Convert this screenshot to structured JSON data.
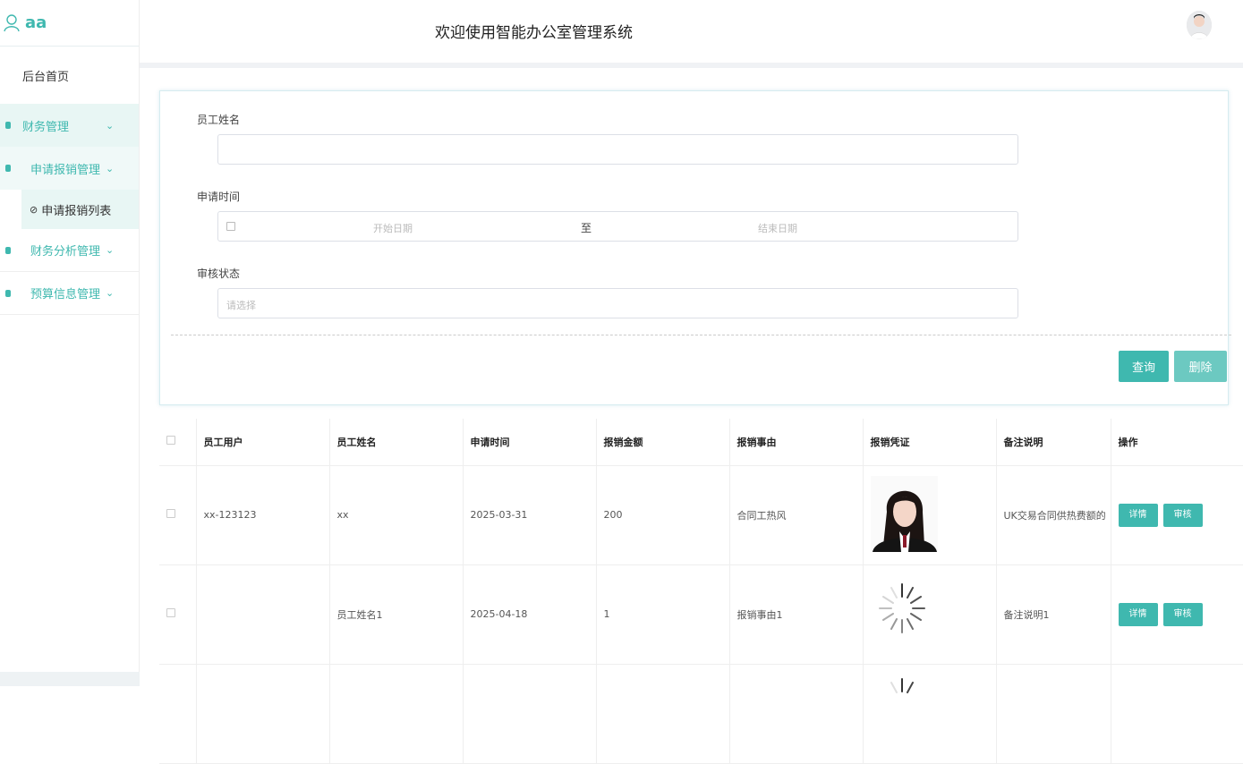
{
  "brand": {
    "name": "aa"
  },
  "sidebar": {
    "home": "后台首页",
    "finance": "财务管理",
    "reimburse": "申请报销管理",
    "reimburse_list": "申请报销列表",
    "analysis": "财务分析管理",
    "budget": "预算信息管理"
  },
  "header": {
    "title": "欢迎使用智能办公室管理系统"
  },
  "search": {
    "name_label": "员工姓名",
    "name_value": "",
    "time_label": "申请时间",
    "start_placeholder": "开始日期",
    "range_separator": "至",
    "end_placeholder": "结束日期",
    "status_label": "审核状态",
    "status_placeholder": "请选择",
    "query_label": "查询",
    "delete_label": "删除"
  },
  "table": {
    "headers": [
      "员工用户",
      "员工姓名",
      "申请时间",
      "报销金额",
      "报销事由",
      "报销凭证",
      "备注说明",
      "操作"
    ],
    "detail_label": "详情",
    "review_label": "审核",
    "rows": [
      {
        "user": "xx-123123",
        "name": "xx",
        "time": "2025-03-31",
        "amount": "200",
        "reason": "合同工热风",
        "voucher": "photo",
        "note": "UK交易合同供热费额的"
      },
      {
        "user": "",
        "name": "员工姓名1",
        "time": "2025-04-18",
        "amount": "1",
        "reason": "报销事由1",
        "voucher": "loading",
        "note": "备注说明1"
      }
    ]
  },
  "colors": {
    "accent": "#3fb8af"
  }
}
